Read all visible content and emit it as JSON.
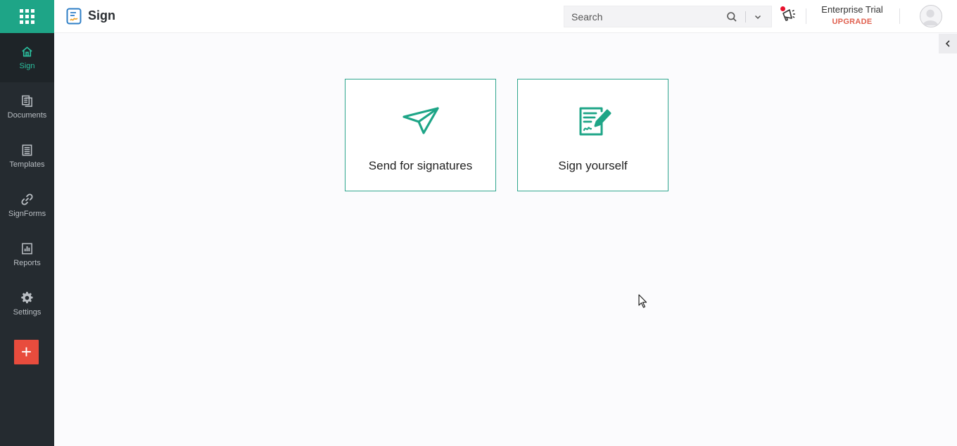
{
  "app": {
    "title": "Sign"
  },
  "sidebar": {
    "items": [
      {
        "label": "Sign",
        "icon": "home-icon",
        "active": true
      },
      {
        "label": "Documents",
        "icon": "documents-icon"
      },
      {
        "label": "Templates",
        "icon": "templates-icon"
      },
      {
        "label": "SignForms",
        "icon": "link-icon"
      },
      {
        "label": "Reports",
        "icon": "reports-icon"
      },
      {
        "label": "Settings",
        "icon": "gear-icon"
      }
    ],
    "add_label": "+"
  },
  "header": {
    "search_placeholder": "Search",
    "plan": "Enterprise Trial",
    "upgrade": "UPGRADE"
  },
  "actions": {
    "send": {
      "label": "Send for signatures",
      "icon": "paper-plane-icon"
    },
    "self": {
      "label": "Sign yourself",
      "icon": "sign-document-icon"
    }
  },
  "colors": {
    "accent": "#1ea587",
    "sidebar_bg": "#252b30",
    "add_button": "#e84c3d",
    "upgrade": "#e0604f"
  }
}
